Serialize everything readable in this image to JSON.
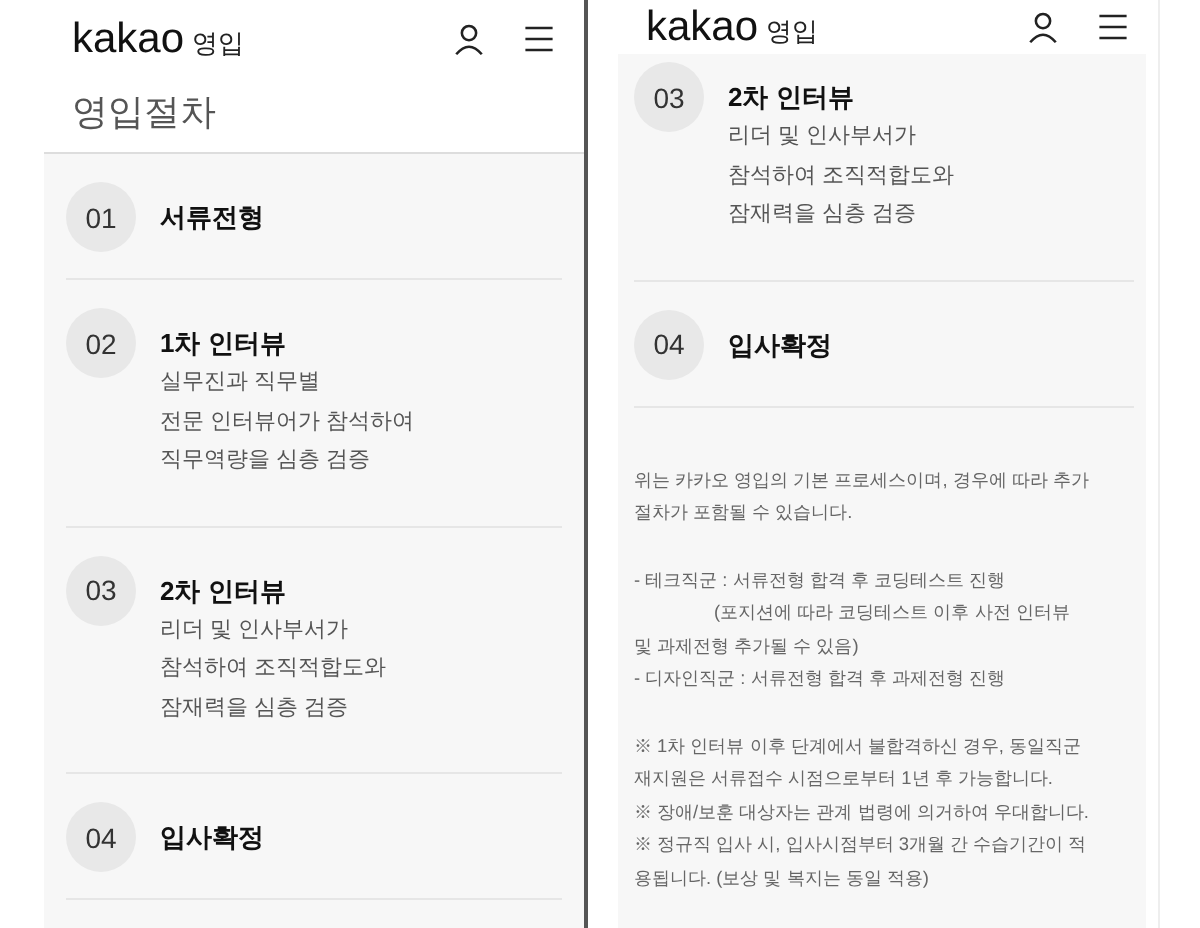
{
  "panels": [
    {
      "brand": "kakao",
      "brand_sub": "영입",
      "title": "영입절차",
      "steps": [
        {
          "number": "01",
          "title": "서류전형"
        },
        {
          "number": "02",
          "title": "1차 인터뷰",
          "lines": [
            "실무진과 직무별",
            "전문 인터뷰어가 참석하여",
            "직무역량을 심층 검증"
          ]
        },
        {
          "number": "03",
          "title": "2차 인터뷰",
          "lines": [
            "리더 및 인사부서가",
            "참석하여 조직적합도와",
            "잠재력을 심층 검증"
          ]
        },
        {
          "number": "04",
          "title": "입사확정"
        }
      ]
    },
    {
      "brand": "kakao",
      "brand_sub": "영입",
      "steps": [
        {
          "number": "03",
          "title": "2차 인터뷰",
          "lines": [
            "리더 및 인사부서가",
            "참석하여 조직적합도와",
            "잠재력을 심층 검증"
          ]
        },
        {
          "number": "04",
          "title": "입사확정"
        }
      ],
      "notes": [
        [
          {
            "text": "위는 카카오 영입의 기본 프로세스이며, 경우에 따라 추가",
            "kind": "plain"
          },
          {
            "text": "절차가 포함될 수 있습니다.",
            "kind": "plain"
          }
        ],
        [
          {
            "text": "- 테크직군 : 서류전형 합격 후 코딩테스트 진행",
            "kind": "plain"
          },
          {
            "text": "(포지션에 따라 코딩테스트 이후 사전 인터뷰",
            "kind": "indent"
          },
          {
            "text": "및 과제전형 추가될 수 있음)",
            "kind": "plain"
          },
          {
            "text": "- 디자인직군 : 서류전형 합격 후 과제전형 진행",
            "kind": "plain"
          }
        ],
        [
          {
            "text": "※ 1차 인터뷰 이후 단계에서 불합격하신 경우, 동일직군",
            "kind": "plain"
          },
          {
            "text": "재지원은 서류접수 시점으로부터 1년 후 가능합니다.",
            "kind": "plain"
          },
          {
            "text": "※ 장애/보훈 대상자는 관계 법령에 의거하여 우대합니다.",
            "kind": "plain"
          },
          {
            "text": "※ 정규직 입사 시, 입사시점부터 3개월 간 수습기간이 적",
            "kind": "plain"
          },
          {
            "text": "용됩니다. (보상 및 복지는 동일 적용)",
            "kind": "plain"
          }
        ]
      ]
    }
  ]
}
